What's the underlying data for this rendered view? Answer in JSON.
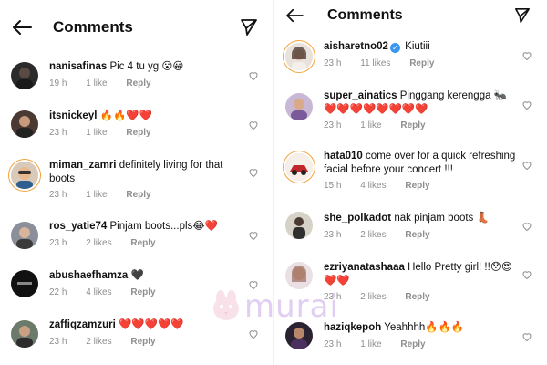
{
  "left": {
    "title": "Comments",
    "comments": [
      {
        "user": "nanisafinas",
        "text": "Pic 4 tu yg 😮😀",
        "time": "19 h",
        "likes": "1 like",
        "reply": "Reply"
      },
      {
        "user": "itsnickeyl",
        "text": "🔥🔥❤️❤️",
        "time": "23 h",
        "likes": "1 like",
        "reply": "Reply"
      },
      {
        "user": "miman_zamri",
        "text": "definitely living for that boots",
        "time": "23 h",
        "likes": "1 like",
        "reply": "Reply"
      },
      {
        "user": "ros_yatie74",
        "text": "Pinjam boots...pls😂❤️",
        "time": "23 h",
        "likes": "2 likes",
        "reply": "Reply"
      },
      {
        "user": "abushaefhamza",
        "text": "🖤",
        "time": "22 h",
        "likes": "4 likes",
        "reply": "Reply"
      },
      {
        "user": "zaffiqzamzuri",
        "text": "❤️❤️❤️❤️❤️",
        "time": "23 h",
        "likes": "2 likes",
        "reply": "Reply"
      }
    ]
  },
  "right": {
    "title": "Comments",
    "comments": [
      {
        "user": "aisharetno02",
        "text": "Kiutiii",
        "time": "23 h",
        "likes": "11 likes",
        "reply": "Reply"
      },
      {
        "user": "super_ainatics",
        "text": "Pinggang kerengga 🐜 ❤️❤️❤️❤️❤️❤️❤️❤️",
        "time": "23 h",
        "likes": "1 like",
        "reply": "Reply"
      },
      {
        "user": "hata010",
        "text": "come over for a quick refreshing facial before your concert !!!",
        "time": "15 h",
        "likes": "4 likes",
        "reply": "Reply"
      },
      {
        "user": "she_polkadot",
        "text": "nak pinjam boots 👢",
        "time": "23 h",
        "likes": "2 likes",
        "reply": "Reply"
      },
      {
        "user": "ezriyanatashaaa",
        "text": "Hello Pretty girl! !!😯😍 ❤️❤️",
        "time": "23 h",
        "likes": "2 likes",
        "reply": "Reply"
      },
      {
        "user": "haziqkepoh",
        "text": "Yeahhhh🔥🔥🔥",
        "time": "23 h",
        "likes": "1 like",
        "reply": "Reply"
      }
    ]
  },
  "watermark": {
    "text": "murai"
  },
  "colors": {
    "story_ring": "#f2a23a",
    "verified": "#3897f0",
    "meta": "#8e8e8e",
    "watermark": "#c8a8e4"
  }
}
